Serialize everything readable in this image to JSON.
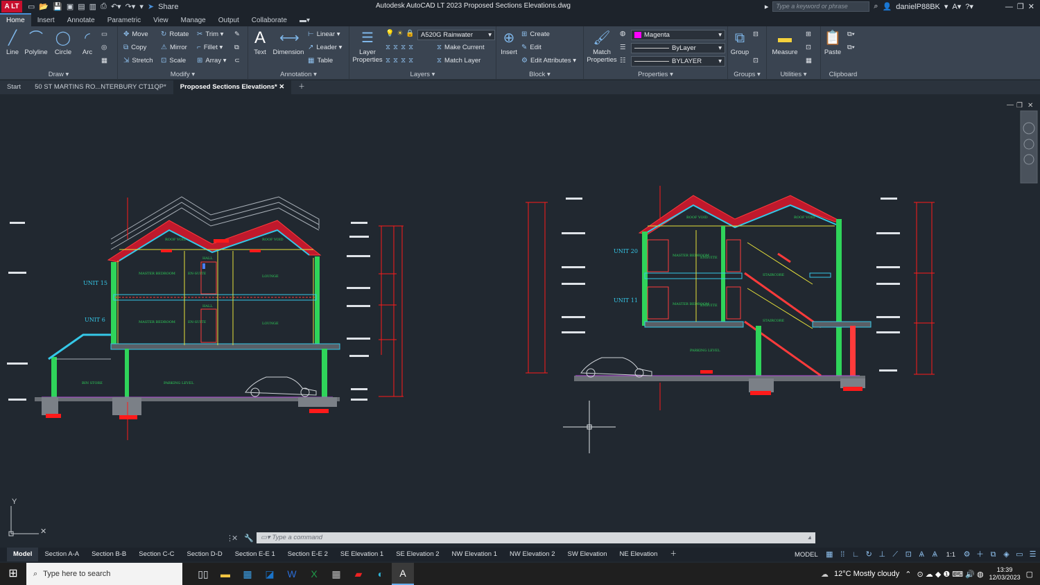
{
  "app": {
    "badge": "A LT",
    "title": "Autodesk AutoCAD LT 2023   Proposed Sections  Elevations.dwg",
    "share": "Share"
  },
  "search": {
    "placeholder": "Type a keyword or phrase"
  },
  "user": {
    "name": "danielP88BK"
  },
  "menu": [
    "Home",
    "Insert",
    "Annotate",
    "Parametric",
    "View",
    "Manage",
    "Output",
    "Collaborate"
  ],
  "ribbon": {
    "draw": {
      "title": "Draw",
      "line": "Line",
      "polyline": "Polyline",
      "circle": "Circle",
      "arc": "Arc"
    },
    "modify": {
      "title": "Modify",
      "move": "Move",
      "rotate": "Rotate",
      "trim": "Trim",
      "copy": "Copy",
      "mirror": "Mirror",
      "fillet": "Fillet",
      "stretch": "Stretch",
      "scale": "Scale",
      "array": "Array"
    },
    "annotation": {
      "title": "Annotation",
      "text": "Text",
      "dimension": "Dimension",
      "linear": "Linear",
      "leader": "Leader",
      "table": "Table"
    },
    "layers": {
      "title": "Layers",
      "layer_properties": "Layer Properties",
      "current_layer": "A520G Rainwater",
      "make_current": "Make Current",
      "match_layer": "Match Layer"
    },
    "block": {
      "title": "Block",
      "insert": "Insert",
      "create": "Create",
      "edit": "Edit",
      "edit_attributes": "Edit Attributes"
    },
    "properties": {
      "title": "Properties",
      "match_properties": "Match Properties",
      "color": "Magenta",
      "linetype": "ByLayer",
      "lineweight": "BYLAYER"
    },
    "groups": {
      "title": "Groups",
      "group": "Group"
    },
    "utilities": {
      "title": "Utilities",
      "measure": "Measure"
    },
    "clipboard": {
      "title": "Clipboard",
      "paste": "Paste"
    }
  },
  "doc_tabs": [
    "Start",
    "50 ST MARTINS RO...NTERBURY CT11QP*",
    "Proposed Sections  Elevations*"
  ],
  "drawing": {
    "left_labels": {
      "unit_upper": "UNIT 15",
      "unit_lower": "UNIT 6",
      "roof_void_1": "ROOF VOID",
      "roof_void_2": "ROOF VOID",
      "master_bed_1": "MASTER BEDROOM",
      "master_bed_2": "MASTER BEDROOM",
      "ensuite_1": "EN-SUITE",
      "ensuite_2": "EN-SUITE",
      "hall_1": "HALL",
      "hall_2": "HALL",
      "lounge_1": "LOUNGE",
      "lounge_2": "LOUNGE",
      "bin_store": "BIN STORE",
      "parking": "PARKING LEVEL"
    },
    "right_labels": {
      "unit_upper": "UNIT 20",
      "unit_lower": "UNIT 11",
      "roof_void_1": "ROOF VOID",
      "roof_void_2": "ROOF VOID",
      "master_bed_1": "MASTER BEDROOM",
      "master_bed_2": "MASTER BEDROOM",
      "ensuite_1": "ENSUITE",
      "ensuite_2": "ENSUITE",
      "staircore_1": "STAIRCORE",
      "staircore_2": "STAIRCORE",
      "parking": "PARKING LEVEL"
    },
    "axis_y": "Y"
  },
  "command": {
    "placeholder": "Type  a  command"
  },
  "layout_tabs": [
    "Model",
    "Section A-A",
    "Section B-B",
    "Section C-C",
    "Section D-D",
    "Section E-E 1",
    "Section E-E 2",
    "SE Elevation 1",
    "SE Elevation 2",
    "NW Elevation 1",
    "NW Elevation 2",
    "SW Elevation",
    "NE Elevation"
  ],
  "status": {
    "model": "MODEL",
    "scale": "1:1"
  },
  "taskbar": {
    "search": "Type here to search",
    "weather": "12°C  Mostly cloudy",
    "time": "13:39",
    "date": "12/03/2023"
  }
}
